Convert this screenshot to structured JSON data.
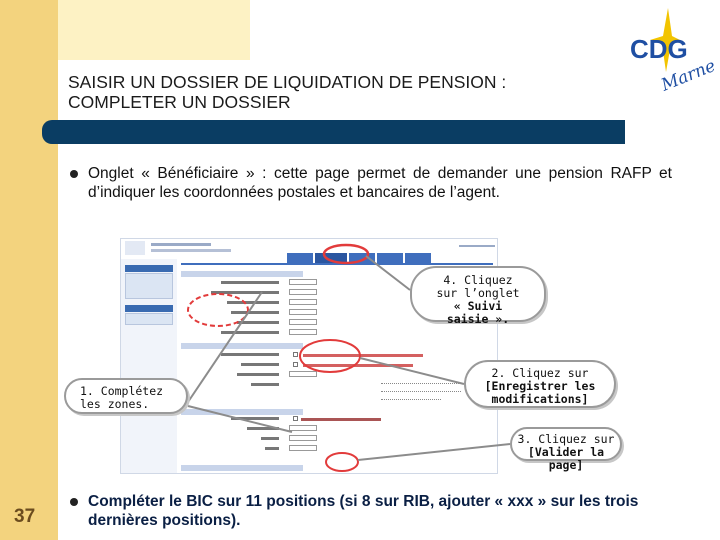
{
  "slide": {
    "title_line1": "SAISIR UN DOSSIER DE LIQUIDATION DE PENSION :",
    "title_line2": "COMPLETER UN DOSSIER",
    "page_number": "37",
    "bullet1": "Onglet « Bénéficiaire » : cette page permet de demander une pension RAFP et d’indiquer les coordonnées postales et bancaires de l’agent.",
    "bullet2": "Compléter le BIC sur 11 positions (si 8 sur RIB, ajouter « xxx » sur les trois dernières positions)."
  },
  "logo": {
    "text_main": "CDG",
    "text_script": "Marne",
    "colors": {
      "blue": "#1f4fa3",
      "yellow": "#f2c400"
    }
  },
  "callouts": {
    "step1": {
      "line1": "1. Complétez",
      "line2": "les zones."
    },
    "step4": {
      "line1": "4. Cliquez",
      "line2": "sur l’onglet",
      "line3": "« Suivi",
      "line4": "saisie »."
    },
    "step2": {
      "line1": "2. Cliquez sur",
      "line2": "[Enregistrer les",
      "line3": "modifications]"
    },
    "step3": {
      "line1": "3. Cliquez sur",
      "line2": "[Valider la page]"
    }
  },
  "colors": {
    "left_bar": "#f3d37e",
    "top_band": "#fdf2c4",
    "title_bar": "#0a3d63",
    "highlight_circle": "#e23b3b",
    "arrow": "#8c8c8c"
  }
}
